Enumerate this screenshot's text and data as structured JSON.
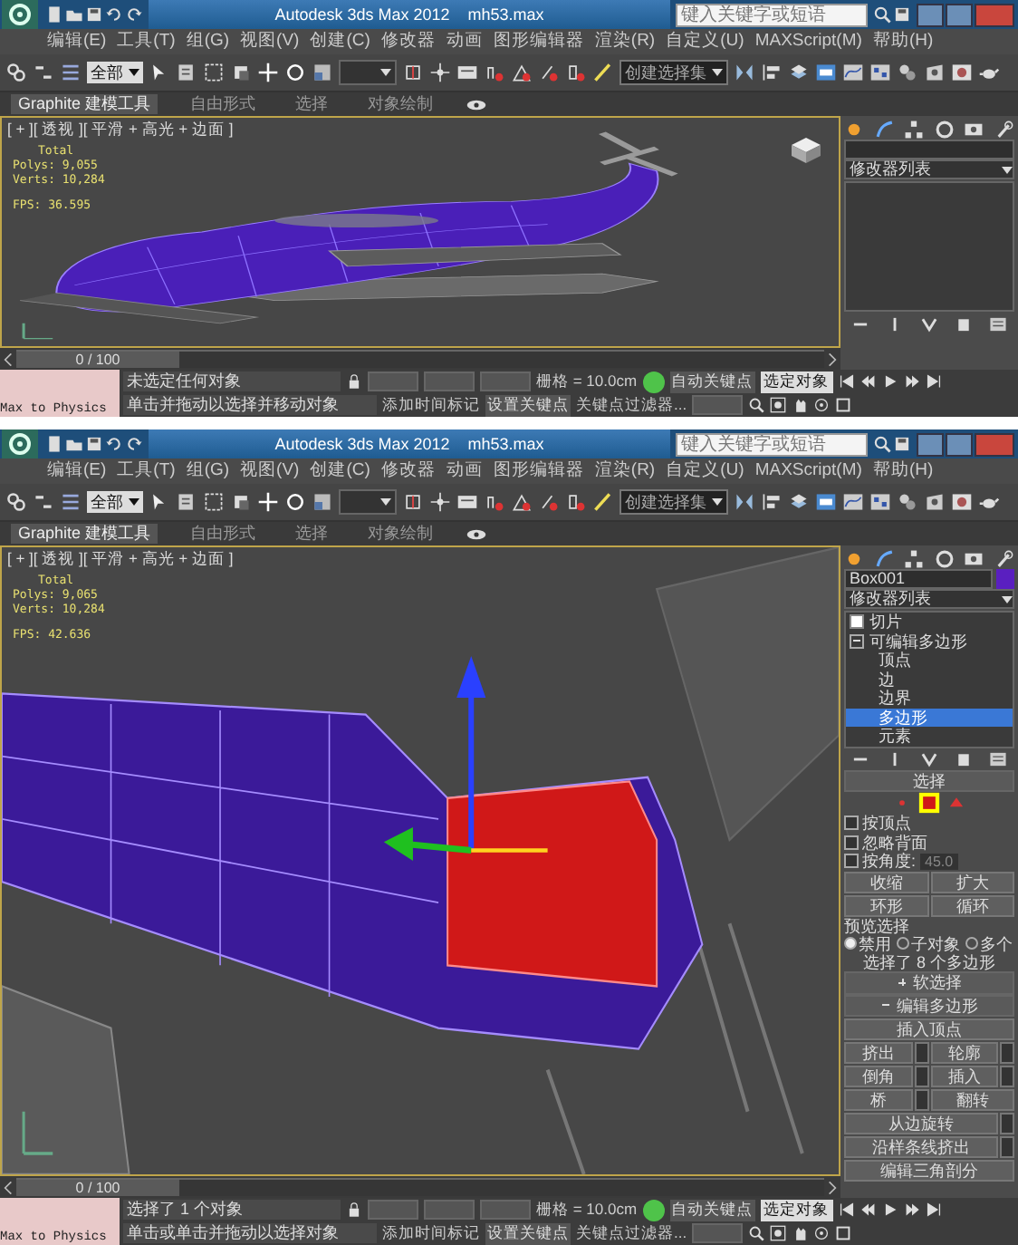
{
  "screens": [
    {
      "title_bar": {
        "app": "Autodesk 3ds Max 2012",
        "file": "mh53.max",
        "search_placeholder": "键入关键字或短语"
      },
      "menu": [
        "编辑(E)",
        "工具(T)",
        "组(G)",
        "视图(V)",
        "创建(C)",
        "修改器",
        "动画",
        "图形编辑器",
        "渲染(R)",
        "自定义(U)",
        "MAXScript(M)",
        "帮助(H)"
      ],
      "toolbar": {
        "selection_filter": "全部",
        "named_selection": "创建选择集"
      },
      "ribbon_tabs": [
        {
          "label": "Graphite 建模工具",
          "selected": true
        },
        {
          "label": "自由形式",
          "selected": false
        },
        {
          "label": "选择",
          "selected": false
        },
        {
          "label": "对象绘制",
          "selected": false
        }
      ],
      "viewport": {
        "label": "[ + ][ 透视 ][ 平滑 + 高光 + 边面 ]",
        "kind": "helicopter",
        "stats": {
          "heading": "Total",
          "rows": [
            "Polys: 9,055",
            "Verts: 10,284"
          ],
          "fps": "FPS: 36.595"
        }
      },
      "command_panel": {
        "modifier_list": "修改器列表"
      },
      "timeline": {
        "position": "0 / 100"
      },
      "status": {
        "script_label": "Max to Physics",
        "prompt": "未选定任何对象",
        "hint": "单击并拖动以选择并移动对象",
        "grid": "栅格 = 10.0cm",
        "time_tag": "添加时间标记",
        "auto_key": "自动关键点",
        "key_mode": "选定对象",
        "set_key": "设置关键点",
        "key_filters": "关键点过滤器..."
      }
    },
    {
      "title_bar": {
        "app": "Autodesk 3ds Max 2012",
        "file": "mh53.max",
        "search_placeholder": "键入关键字或短语"
      },
      "menu": [
        "编辑(E)",
        "工具(T)",
        "组(G)",
        "视图(V)",
        "创建(C)",
        "修改器",
        "动画",
        "图形编辑器",
        "渲染(R)",
        "自定义(U)",
        "MAXScript(M)",
        "帮助(H)"
      ],
      "toolbar": {
        "selection_filter": "全部",
        "named_selection": "创建选择集"
      },
      "ribbon_tabs": [
        {
          "label": "Graphite 建模工具",
          "selected": true
        },
        {
          "label": "自由形式",
          "selected": false
        },
        {
          "label": "选择",
          "selected": false
        },
        {
          "label": "对象绘制",
          "selected": false
        }
      ],
      "viewport": {
        "label": "[ + ][ 透视 ][ 平滑 + 高光 + 边面 ]",
        "kind": "closeup",
        "stats": {
          "heading": "Total",
          "rows": [
            "Polys: 9,065",
            "Verts: 10,284"
          ],
          "fps": "FPS: 42.636"
        }
      },
      "command_panel": {
        "object_name": "Box001",
        "modifier_list": "修改器列表",
        "stack": [
          {
            "label": "切片",
            "kind": "modifier"
          },
          {
            "label": "可编辑多边形",
            "kind": "base",
            "expanded": true,
            "children": [
              {
                "label": "顶点",
                "selected": false
              },
              {
                "label": "边",
                "selected": false
              },
              {
                "label": "边界",
                "selected": false
              },
              {
                "label": "多边形",
                "selected": true
              },
              {
                "label": "元素",
                "selected": false
              }
            ]
          }
        ],
        "selection": {
          "title": "选择",
          "checkboxes": [
            {
              "label": "按顶点",
              "checked": false
            },
            {
              "label": "忽略背面",
              "checked": false
            },
            {
              "label": "按角度:",
              "checked": false,
              "value": "45.0"
            }
          ],
          "buttons": [
            "收缩",
            "扩大",
            "环形",
            "循环"
          ],
          "preview_title": "预览选择",
          "preview_options": [
            {
              "label": "禁用",
              "selected": true
            },
            {
              "label": "子对象",
              "selected": false
            },
            {
              "label": "多个",
              "selected": false
            }
          ],
          "info": "选择了 8 个多边形"
        },
        "rollouts": [
          {
            "title": "软选择",
            "expanded": false
          },
          {
            "title": "编辑多边形",
            "expanded": true
          }
        ],
        "edit_rows": [
          [
            {
              "label": "插入顶点",
              "settings": false
            }
          ],
          [
            {
              "label": "挤出",
              "settings": true
            },
            {
              "label": "轮廓",
              "settings": true
            }
          ],
          [
            {
              "label": "倒角",
              "settings": true
            },
            {
              "label": "插入",
              "settings": true
            }
          ],
          [
            {
              "label": "桥",
              "settings": true
            },
            {
              "label": "翻转",
              "settings": false
            }
          ],
          [
            {
              "label": "从边旋转",
              "settings": true
            }
          ],
          [
            {
              "label": "沿样条线挤出",
              "settings": true
            }
          ],
          [
            {
              "label": "编辑三角剖分",
              "settings": false
            }
          ]
        ]
      },
      "timeline": {
        "position": "0 / 100"
      },
      "status": {
        "script_label": "Max to Physics",
        "prompt": "选择了 1 个对象",
        "hint": "单击或单击并拖动以选择对象",
        "grid": "栅格 = 10.0cm",
        "time_tag": "添加时间标记",
        "auto_key": "自动关键点",
        "key_mode": "选定对象",
        "set_key": "设置关键点",
        "key_filters": "关键点过滤器..."
      }
    }
  ]
}
